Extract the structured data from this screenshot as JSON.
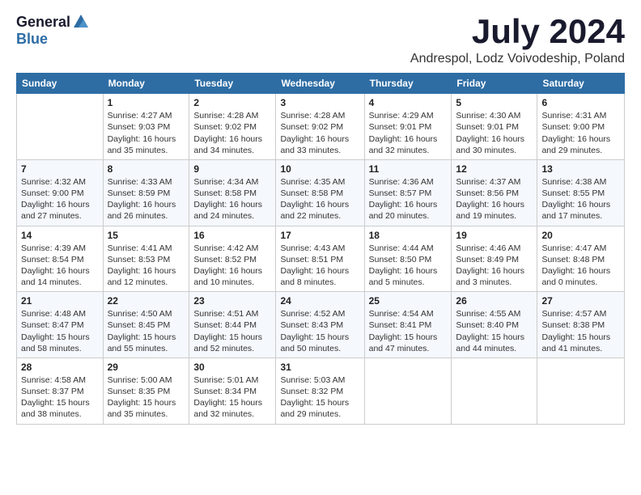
{
  "logo": {
    "general": "General",
    "blue": "Blue"
  },
  "title": "July 2024",
  "subtitle": "Andrespol, Lodz Voivodeship, Poland",
  "headers": [
    "Sunday",
    "Monday",
    "Tuesday",
    "Wednesday",
    "Thursday",
    "Friday",
    "Saturday"
  ],
  "weeks": [
    [
      {
        "day": "",
        "info": ""
      },
      {
        "day": "1",
        "info": "Sunrise: 4:27 AM\nSunset: 9:03 PM\nDaylight: 16 hours\nand 35 minutes."
      },
      {
        "day": "2",
        "info": "Sunrise: 4:28 AM\nSunset: 9:02 PM\nDaylight: 16 hours\nand 34 minutes."
      },
      {
        "day": "3",
        "info": "Sunrise: 4:28 AM\nSunset: 9:02 PM\nDaylight: 16 hours\nand 33 minutes."
      },
      {
        "day": "4",
        "info": "Sunrise: 4:29 AM\nSunset: 9:01 PM\nDaylight: 16 hours\nand 32 minutes."
      },
      {
        "day": "5",
        "info": "Sunrise: 4:30 AM\nSunset: 9:01 PM\nDaylight: 16 hours\nand 30 minutes."
      },
      {
        "day": "6",
        "info": "Sunrise: 4:31 AM\nSunset: 9:00 PM\nDaylight: 16 hours\nand 29 minutes."
      }
    ],
    [
      {
        "day": "7",
        "info": "Sunrise: 4:32 AM\nSunset: 9:00 PM\nDaylight: 16 hours\nand 27 minutes."
      },
      {
        "day": "8",
        "info": "Sunrise: 4:33 AM\nSunset: 8:59 PM\nDaylight: 16 hours\nand 26 minutes."
      },
      {
        "day": "9",
        "info": "Sunrise: 4:34 AM\nSunset: 8:58 PM\nDaylight: 16 hours\nand 24 minutes."
      },
      {
        "day": "10",
        "info": "Sunrise: 4:35 AM\nSunset: 8:58 PM\nDaylight: 16 hours\nand 22 minutes."
      },
      {
        "day": "11",
        "info": "Sunrise: 4:36 AM\nSunset: 8:57 PM\nDaylight: 16 hours\nand 20 minutes."
      },
      {
        "day": "12",
        "info": "Sunrise: 4:37 AM\nSunset: 8:56 PM\nDaylight: 16 hours\nand 19 minutes."
      },
      {
        "day": "13",
        "info": "Sunrise: 4:38 AM\nSunset: 8:55 PM\nDaylight: 16 hours\nand 17 minutes."
      }
    ],
    [
      {
        "day": "14",
        "info": "Sunrise: 4:39 AM\nSunset: 8:54 PM\nDaylight: 16 hours\nand 14 minutes."
      },
      {
        "day": "15",
        "info": "Sunrise: 4:41 AM\nSunset: 8:53 PM\nDaylight: 16 hours\nand 12 minutes."
      },
      {
        "day": "16",
        "info": "Sunrise: 4:42 AM\nSunset: 8:52 PM\nDaylight: 16 hours\nand 10 minutes."
      },
      {
        "day": "17",
        "info": "Sunrise: 4:43 AM\nSunset: 8:51 PM\nDaylight: 16 hours\nand 8 minutes."
      },
      {
        "day": "18",
        "info": "Sunrise: 4:44 AM\nSunset: 8:50 PM\nDaylight: 16 hours\nand 5 minutes."
      },
      {
        "day": "19",
        "info": "Sunrise: 4:46 AM\nSunset: 8:49 PM\nDaylight: 16 hours\nand 3 minutes."
      },
      {
        "day": "20",
        "info": "Sunrise: 4:47 AM\nSunset: 8:48 PM\nDaylight: 16 hours\nand 0 minutes."
      }
    ],
    [
      {
        "day": "21",
        "info": "Sunrise: 4:48 AM\nSunset: 8:47 PM\nDaylight: 15 hours\nand 58 minutes."
      },
      {
        "day": "22",
        "info": "Sunrise: 4:50 AM\nSunset: 8:45 PM\nDaylight: 15 hours\nand 55 minutes."
      },
      {
        "day": "23",
        "info": "Sunrise: 4:51 AM\nSunset: 8:44 PM\nDaylight: 15 hours\nand 52 minutes."
      },
      {
        "day": "24",
        "info": "Sunrise: 4:52 AM\nSunset: 8:43 PM\nDaylight: 15 hours\nand 50 minutes."
      },
      {
        "day": "25",
        "info": "Sunrise: 4:54 AM\nSunset: 8:41 PM\nDaylight: 15 hours\nand 47 minutes."
      },
      {
        "day": "26",
        "info": "Sunrise: 4:55 AM\nSunset: 8:40 PM\nDaylight: 15 hours\nand 44 minutes."
      },
      {
        "day": "27",
        "info": "Sunrise: 4:57 AM\nSunset: 8:38 PM\nDaylight: 15 hours\nand 41 minutes."
      }
    ],
    [
      {
        "day": "28",
        "info": "Sunrise: 4:58 AM\nSunset: 8:37 PM\nDaylight: 15 hours\nand 38 minutes."
      },
      {
        "day": "29",
        "info": "Sunrise: 5:00 AM\nSunset: 8:35 PM\nDaylight: 15 hours\nand 35 minutes."
      },
      {
        "day": "30",
        "info": "Sunrise: 5:01 AM\nSunset: 8:34 PM\nDaylight: 15 hours\nand 32 minutes."
      },
      {
        "day": "31",
        "info": "Sunrise: 5:03 AM\nSunset: 8:32 PM\nDaylight: 15 hours\nand 29 minutes."
      },
      {
        "day": "",
        "info": ""
      },
      {
        "day": "",
        "info": ""
      },
      {
        "day": "",
        "info": ""
      }
    ]
  ]
}
